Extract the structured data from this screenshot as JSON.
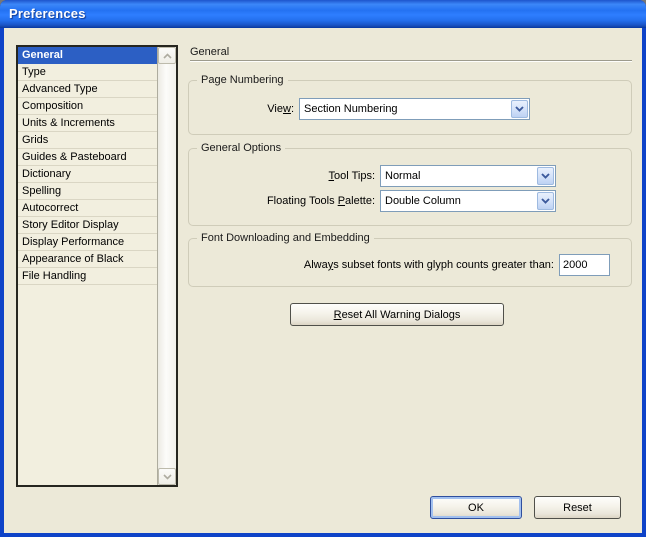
{
  "window": {
    "title": "Preferences"
  },
  "sidebar": {
    "items": [
      {
        "label": "General",
        "selected": true
      },
      {
        "label": "Type",
        "selected": false
      },
      {
        "label": "Advanced Type",
        "selected": false
      },
      {
        "label": "Composition",
        "selected": false
      },
      {
        "label": "Units & Increments",
        "selected": false
      },
      {
        "label": "Grids",
        "selected": false
      },
      {
        "label": "Guides & Pasteboard",
        "selected": false
      },
      {
        "label": "Dictionary",
        "selected": false
      },
      {
        "label": "Spelling",
        "selected": false
      },
      {
        "label": "Autocorrect",
        "selected": false
      },
      {
        "label": "Story Editor Display",
        "selected": false
      },
      {
        "label": "Display Performance",
        "selected": false
      },
      {
        "label": "Appearance of Black",
        "selected": false
      },
      {
        "label": "File Handling",
        "selected": false
      }
    ]
  },
  "panel": {
    "title": "General",
    "page_numbering": {
      "group_label": "Page Numbering",
      "view_label": {
        "pre": "Vie",
        "key": "w",
        "post": ":"
      },
      "view_value": "Section Numbering"
    },
    "general_options": {
      "group_label": "General Options",
      "tool_tips_label": {
        "pre": "",
        "key": "T",
        "post": "ool Tips:"
      },
      "tool_tips_value": "Normal",
      "palette_label": {
        "pre": "Floating Tools ",
        "key": "P",
        "post": "alette:"
      },
      "palette_value": "Double Column"
    },
    "font_embedding": {
      "group_label": "Font Downloading and Embedding",
      "subset_label": {
        "pre": "Alwa",
        "key": "y",
        "post": "s subset fonts with glyph counts greater than:"
      },
      "subset_value": "2000"
    },
    "reset_warnings_label": {
      "pre": "",
      "key": "R",
      "post": "eset All Warning Dialogs"
    }
  },
  "footer": {
    "ok_label": "OK",
    "reset_label": "Reset"
  },
  "icons": {
    "combo_arrow": "chevron-down",
    "scroll_up": "chevron-up",
    "scroll_down": "chevron-down"
  },
  "colors": {
    "titlebar_blue": "#2E7EFF",
    "window_border_blue": "#0E43C8",
    "dialog_bg": "#ECE9D8",
    "selection_blue": "#2C5FC4",
    "combo_border": "#7F9DB9",
    "group_border": "#CFCCB9"
  }
}
